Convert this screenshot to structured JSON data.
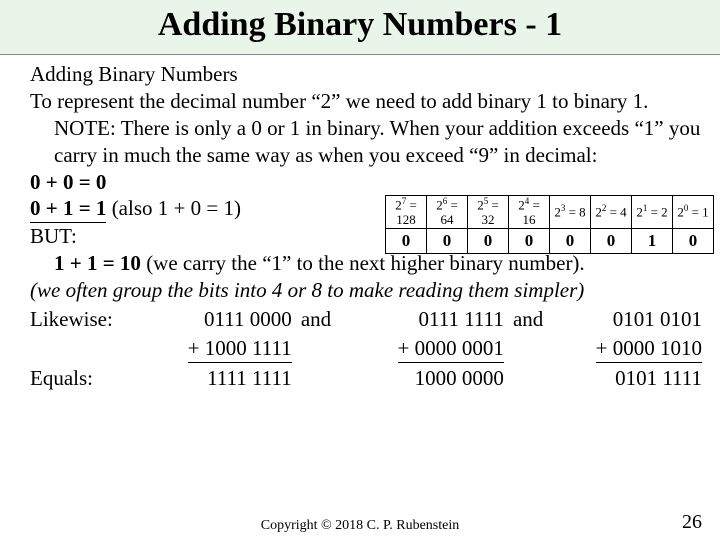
{
  "title": "Adding Binary Numbers - 1",
  "heading": "Adding Binary Numbers",
  "para1": "To represent the decimal number “2” we need to add binary 1 to binary 1. NOTE: There is only a 0 or 1 in binary. When your addition exceeds “1” you carry in much the same way as when you exceed “9” in decimal:",
  "eq1": "0 + 0 = 0",
  "eq2a": "0 + 1 = 1",
  "eq2b": "  (also 1 + 0 = 1)",
  "but": "BUT:",
  "carry_bold": "1 + 1 = 10",
  "carry_rest": " (we carry the “1” to the next higher binary number).",
  "group_note": "(we often group the bits into 4 or 8 to make reading them simpler)",
  "likewise": "Likewise:",
  "equals": "Equals:",
  "and": "and",
  "add": {
    "a1": "0111 0000",
    "b1": "+ 1000 1111",
    "r1": "1111 1111",
    "a2": "0111 1111",
    "b2": "+ 0000 0001",
    "r2": "1000 0000",
    "a3": "0101 0101",
    "b3": "+ 0000 1010",
    "r3": "0101 1111"
  },
  "table": {
    "heads": [
      {
        "exp": "7",
        "val": "128"
      },
      {
        "exp": "6",
        "val": "64"
      },
      {
        "exp": "5",
        "val": "32"
      },
      {
        "exp": "4",
        "val": "16"
      },
      {
        "exp": "3",
        "val": "8"
      },
      {
        "exp": "2",
        "val": "4"
      },
      {
        "exp": "1",
        "val": "2"
      },
      {
        "exp": "0",
        "val": "1"
      }
    ],
    "bits": [
      "0",
      "0",
      "0",
      "0",
      "0",
      "0",
      "1",
      "0"
    ]
  },
  "copyright": "Copyright © 2018 C. P. Rubenstein",
  "page": "26"
}
